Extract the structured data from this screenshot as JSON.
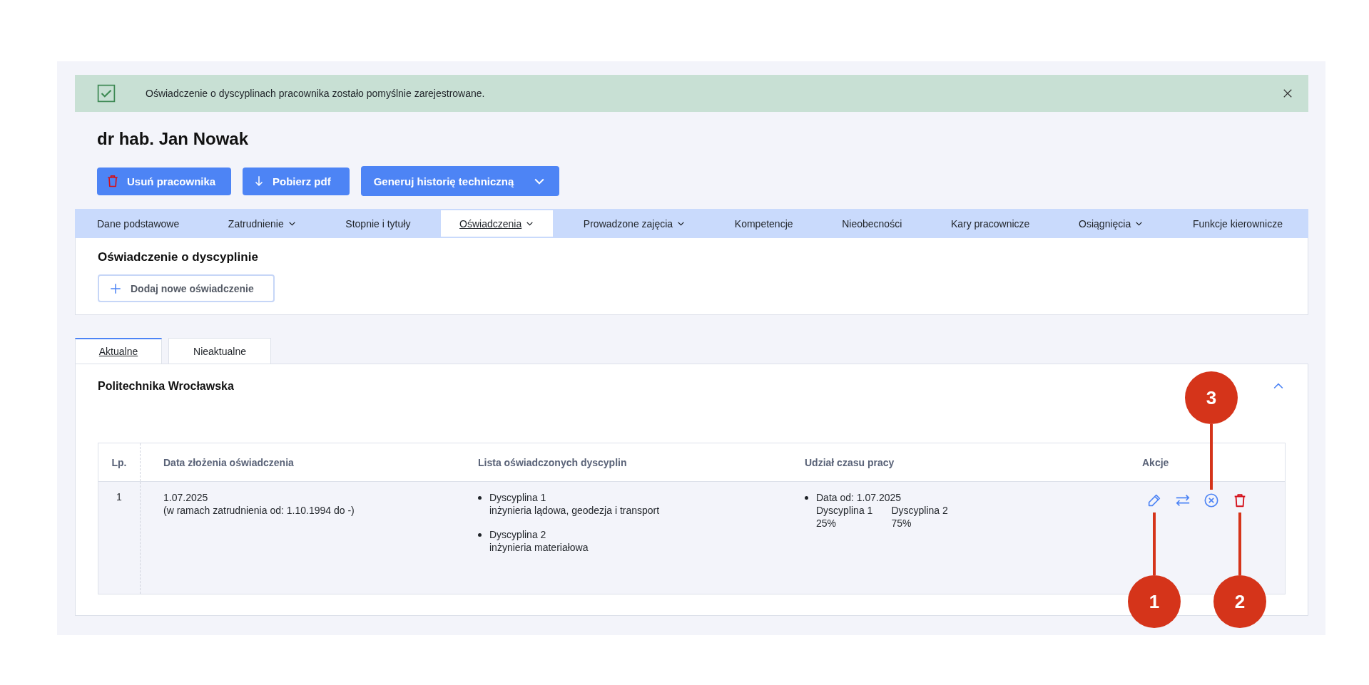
{
  "alert": {
    "message": "Oświadczenie o dyscyplinach pracownika zostało pomyślnie zarejestrowane."
  },
  "employee_name": "dr hab. Jan Nowak",
  "actions": [
    {
      "kind": "delete",
      "label": "Usuń pracownika"
    },
    {
      "kind": "download",
      "label": "Pobierz pdf"
    },
    {
      "kind": "dropdown",
      "label": "Generuj historię techniczną"
    }
  ],
  "nav_tabs": [
    {
      "label": "Dane podstawowe",
      "selected": false,
      "dropdown": false
    },
    {
      "label": "Zatrudnienie",
      "selected": false,
      "dropdown": true
    },
    {
      "label": "Stopnie i tytuły",
      "selected": false,
      "dropdown": false
    },
    {
      "label": "Oświadczenia",
      "selected": true,
      "dropdown": true
    },
    {
      "label": "Prowadzone zajęcia",
      "selected": false,
      "dropdown": true
    },
    {
      "label": "Kompetencje",
      "selected": false,
      "dropdown": false
    },
    {
      "label": "Nieobecności",
      "selected": false,
      "dropdown": false
    },
    {
      "label": "Kary pracownicze",
      "selected": false,
      "dropdown": false
    },
    {
      "label": "Osiągnięcia",
      "selected": false,
      "dropdown": true
    },
    {
      "label": "Funkcje kierownicze",
      "selected": false,
      "dropdown": false
    }
  ],
  "section": {
    "title": "Oświadczenie o dyscyplinie",
    "add_button": "Dodaj nowe oświadczenie"
  },
  "status_tabs": [
    {
      "label": "Aktualne",
      "selected": true
    },
    {
      "label": "Nieaktualne",
      "selected": false
    }
  ],
  "card": {
    "title": "Politechnika Wrocławska",
    "expanded": true
  },
  "table": {
    "columns": [
      "Lp.",
      "Data złożenia oświadczenia",
      "Lista oświadczonych dyscyplin",
      "Udział czasu pracy",
      "Akcje"
    ],
    "rows": [
      {
        "lp": "1",
        "date": "1.07.2025",
        "date_note": "(w ramach zatrudnienia od: 1.10.1994 do -)",
        "disciplines": [
          {
            "name": "Dyscyplina 1",
            "field": "inżynieria lądowa, geodezja i transport"
          },
          {
            "name": "Dyscyplina 2",
            "field": "inżynieria materiałowa"
          }
        ],
        "shares": [
          {
            "date": "Data od: 1.07.2025",
            "items": [
              {
                "name": "Dyscyplina 1",
                "share": "25%"
              },
              {
                "name": "Dyscyplina 2",
                "share": "75%"
              }
            ]
          }
        ],
        "actions": [
          {
            "kind": "edit",
            "callout": "1"
          },
          {
            "kind": "swap"
          },
          {
            "kind": "cancel",
            "callout": "3"
          },
          {
            "kind": "delete",
            "callout": "2"
          }
        ]
      }
    ]
  }
}
